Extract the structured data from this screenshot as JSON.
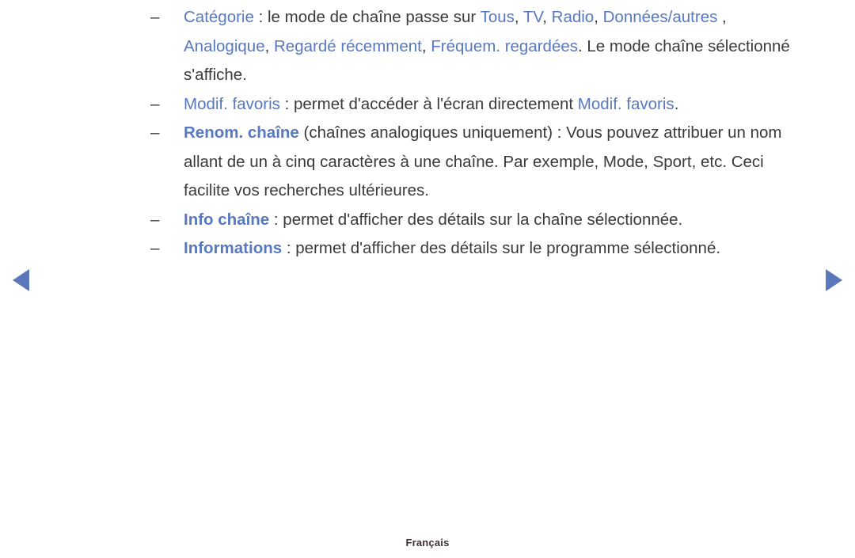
{
  "page": {
    "background_color": "#ffffff",
    "text_color": "#3a3a3a",
    "accent_color": "#5878bf",
    "footer_label": "Français"
  },
  "nav": {
    "prev_icon": "triangle-left-icon",
    "next_icon": "triangle-right-icon"
  },
  "bullets": [
    {
      "dash": "–",
      "segments": [
        {
          "text": "Catégorie",
          "style": "blue"
        },
        {
          "text": " : le mode de chaîne passe sur ",
          "style": "plain"
        },
        {
          "text": "Tous",
          "style": "blue"
        },
        {
          "text": ", ",
          "style": "plain"
        },
        {
          "text": "TV",
          "style": "blue"
        },
        {
          "text": ", ",
          "style": "plain"
        },
        {
          "text": "Radio",
          "style": "blue"
        },
        {
          "text": ", ",
          "style": "plain"
        },
        {
          "text": "Données/autres",
          "style": "blue"
        },
        {
          "text": " , ",
          "style": "plain"
        },
        {
          "text": "Analogique",
          "style": "blue"
        },
        {
          "text": ", ",
          "style": "plain"
        },
        {
          "text": "Regardé récemment",
          "style": "blue"
        },
        {
          "text": ", ",
          "style": "plain"
        },
        {
          "text": "Fréquem. regardées",
          "style": "blue"
        },
        {
          "text": ". Le mode chaîne sélectionné s'affiche.",
          "style": "plain"
        }
      ]
    },
    {
      "dash": "–",
      "segments": [
        {
          "text": "Modif. favoris",
          "style": "blue"
        },
        {
          "text": " : permet d'accéder à l'écran directement ",
          "style": "plain"
        },
        {
          "text": "Modif. favoris",
          "style": "blue"
        },
        {
          "text": ".",
          "style": "plain"
        }
      ]
    },
    {
      "dash": "–",
      "segments": [
        {
          "text": "Renom. chaîne",
          "style": "blue-bold"
        },
        {
          "text": " (chaînes analogiques uniquement) : Vous pouvez attribuer un nom allant de un à cinq caractères à une chaîne. Par exemple, Mode, Sport, etc. Ceci facilite vos recherches ultérieures.",
          "style": "plain"
        }
      ]
    },
    {
      "dash": "–",
      "segments": [
        {
          "text": "Info chaîne",
          "style": "blue-bold"
        },
        {
          "text": " : permet d'afficher des détails sur la chaîne sélectionnée.",
          "style": "plain"
        }
      ]
    },
    {
      "dash": "–",
      "segments": [
        {
          "text": "Informations",
          "style": "blue-bold"
        },
        {
          "text": " : permet d'afficher des détails sur le programme sélectionné.",
          "style": "plain"
        }
      ]
    }
  ]
}
